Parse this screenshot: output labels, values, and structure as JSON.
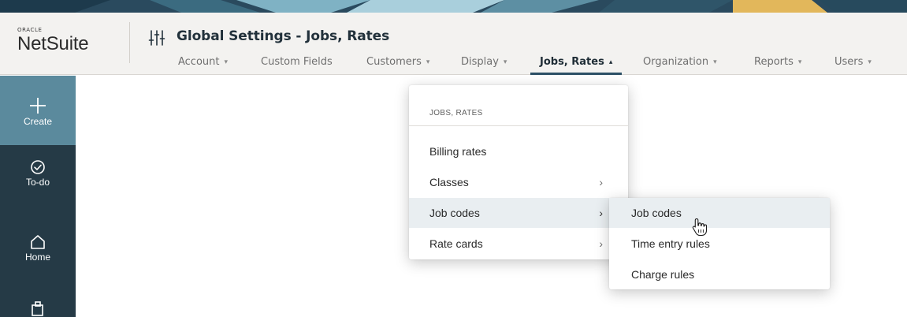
{
  "brand": {
    "oracle": "ORACLE",
    "name": "NetSuite"
  },
  "header": {
    "title": "Global Settings - Jobs, Rates",
    "settings_icon": "sliders-icon",
    "tabs": [
      {
        "label": "Account",
        "active": false
      },
      {
        "label": "Custom Fields",
        "active": false
      },
      {
        "label": "Customers",
        "active": false
      },
      {
        "label": "Display",
        "active": false
      },
      {
        "label": "Jobs, Rates",
        "active": true
      },
      {
        "label": "Organization",
        "active": false
      },
      {
        "label": "Reports",
        "active": false
      },
      {
        "label": "Users",
        "active": false
      }
    ]
  },
  "sidebar": {
    "items": [
      {
        "label": "Create",
        "icon": "plus-icon"
      },
      {
        "label": "To-do",
        "icon": "check-circle-icon"
      },
      {
        "label": "Home",
        "icon": "home-icon"
      },
      {
        "label": "",
        "icon": "clipboard-icon"
      }
    ]
  },
  "menu": {
    "heading": "JOBS, RATES",
    "items": [
      {
        "label": "Billing rates",
        "has_submenu": false
      },
      {
        "label": "Classes",
        "has_submenu": true
      },
      {
        "label": "Job codes",
        "has_submenu": true,
        "highlighted": true
      },
      {
        "label": "Rate cards",
        "has_submenu": true
      }
    ],
    "chevron": "›"
  },
  "submenu": {
    "items": [
      {
        "label": "Job codes",
        "highlighted": true
      },
      {
        "label": "Time entry rules"
      },
      {
        "label": "Charge rules"
      }
    ]
  },
  "caret_down": "▾",
  "caret_up": "▴",
  "colors": {
    "sidebar_bg": "#253a46",
    "create_bg": "#5b8a9d",
    "header_bg": "#f3f2f0",
    "active_tab_underline": "#2c5066",
    "menu_highlight": "#e9eef1"
  }
}
